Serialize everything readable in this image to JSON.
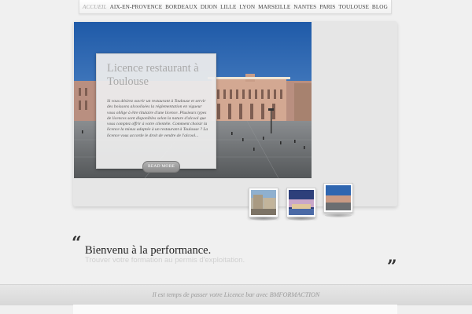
{
  "nav": {
    "items": [
      {
        "label": "ACCUEIL",
        "active": true
      },
      {
        "label": "AIX-EN-PROVENCE"
      },
      {
        "label": "BORDEAUX"
      },
      {
        "label": "DIJON"
      },
      {
        "label": "LILLE"
      },
      {
        "label": "LYON"
      },
      {
        "label": "MARSEILLE"
      },
      {
        "label": "NANTES"
      },
      {
        "label": "PARIS"
      },
      {
        "label": "TOULOUSE"
      },
      {
        "label": "BLOG"
      }
    ]
  },
  "slider": {
    "caption_title": "Licence restaurant à Toulouse",
    "caption_text": "Si vous désirez ouvrir un restaurant à Toulouse et servir des boissons alcoolisées la réglementation en vigueur vous oblige à être titulaire d'une licence. Plusieurs types de licences sont disponibles selon la nature d'alcool que vous comptez offrir à votre clientèle. Comment choisir la licence la mieux adaptée à un restaurant à Toulouse ? La licence vous accorde le droit de vendre de l'alcool...",
    "read_more": "READ MORE"
  },
  "welcome": {
    "quote_open": "“",
    "quote_close": "”",
    "title": "Bienvenu à la performance.",
    "subtitle": "Trouver votre formation au permis d'exploitation."
  },
  "banner": {
    "text": "Il est temps de passer votre Licence bar avec BMFORMACTION"
  },
  "colors": {
    "sky": "#2f6bb5",
    "building": "#c89a86",
    "square": "#6b6f72"
  }
}
